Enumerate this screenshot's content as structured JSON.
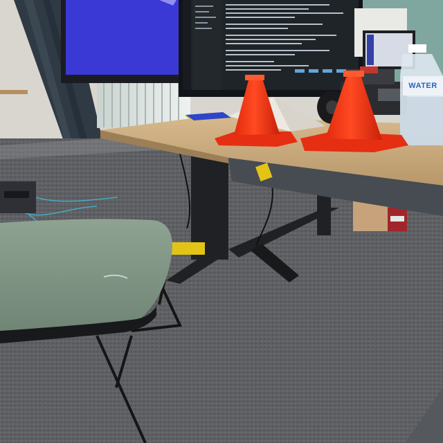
{
  "scene": {
    "water_bottle": {
      "label": "WATER"
    }
  }
}
